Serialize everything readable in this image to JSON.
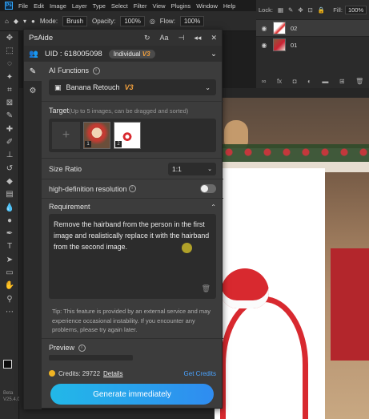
{
  "menubar": {
    "items": [
      "File",
      "Edit",
      "Image",
      "Layer",
      "Type",
      "Select",
      "Filter",
      "View",
      "Plugins",
      "Window",
      "Help"
    ]
  },
  "options": {
    "mode_label": "Mode:",
    "mode_value": "Brush",
    "opacity_label": "Opacity:",
    "opacity_value": "100%",
    "flow_label": "Flow:",
    "flow_value": "100%",
    "fill_label": "Fill:",
    "fill_value": "100%"
  },
  "layers": {
    "lock_label": "Lock:",
    "items": [
      {
        "name": "02"
      },
      {
        "name": "01"
      }
    ],
    "footer_icons": [
      "link-icon",
      "fx-icon",
      "mask-icon",
      "adjustment-icon",
      "folder-icon",
      "new-layer-icon",
      "trash-icon"
    ]
  },
  "toolbar": {
    "icons": [
      "move-icon",
      "marquee-icon",
      "lasso-icon",
      "magic-wand-icon",
      "crop-icon",
      "frame-icon",
      "eyedropper-icon",
      "healing-icon",
      "brush-icon",
      "stamp-icon",
      "history-brush-icon",
      "eraser-icon",
      "gradient-icon",
      "blur-icon",
      "dodge-icon",
      "pen-icon",
      "type-icon",
      "path-select-icon",
      "shape-icon",
      "hand-icon",
      "zoom-icon",
      "more-icon"
    ],
    "version": "Beta\nV25.4.0"
  },
  "panel": {
    "title": "PsAide",
    "uid": "UID : 618005098",
    "plan": "Individual",
    "plan_badge": "V3",
    "ai_functions_label": "AI Functions",
    "function_value": "Banana Retouch",
    "function_badge": "V3",
    "target_label": "Target",
    "target_hint": "(Up to 5 images, can be dragged and sorted)",
    "thumb_numbers": [
      "1",
      "2"
    ],
    "size_ratio_label": "Size Ratio",
    "size_ratio_value": "1:1",
    "hd_label": "high-definition resolution",
    "hd_enabled": false,
    "requirement_label": "Requirement",
    "requirement_text": "Remove the hairband from the person in the first image and realistically replace it with the hairband from the second image.",
    "tip": "Tip: This feature is provided by an external service and may experience occasional instability. If you encounter any problems, please try again later.",
    "preview_label": "Preview",
    "credits_label": "Credits: 29722",
    "details_label": "Details",
    "get_credits_label": "Get Credits",
    "generate_label": "Generate immediately"
  }
}
